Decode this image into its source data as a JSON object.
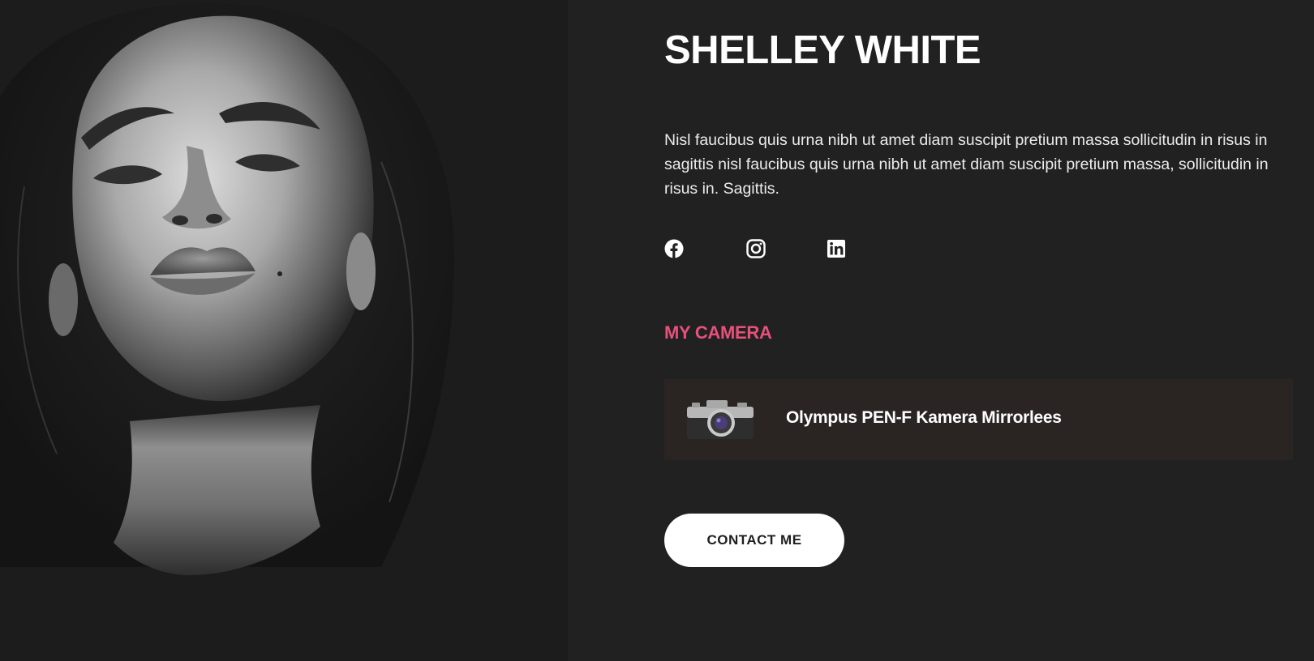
{
  "profile": {
    "name": "SHELLEY WHITE",
    "bio": "Nisl faucibus quis urna nibh ut amet diam suscipit pretium massa sollicitudin in risus in sagittis nisl faucibus quis urna nibh ut amet diam suscipit pretium massa, sollicitudin in risus in. Sagittis.",
    "portrait_icon": "portrait-photo"
  },
  "socials": [
    {
      "network": "facebook",
      "icon": "facebook-icon"
    },
    {
      "network": "instagram",
      "icon": "instagram-icon"
    },
    {
      "network": "linkedin",
      "icon": "linkedin-icon"
    }
  ],
  "camera": {
    "heading": "MY CAMERA",
    "model": "Olympus PEN-F Kamera Mirrorlees",
    "thumb_icon": "camera-icon"
  },
  "cta": {
    "label": "CONTACT ME"
  },
  "colors": {
    "background": "#212121",
    "accent": "#e8507c",
    "card": "#2a2423",
    "button": "#ffffff"
  }
}
